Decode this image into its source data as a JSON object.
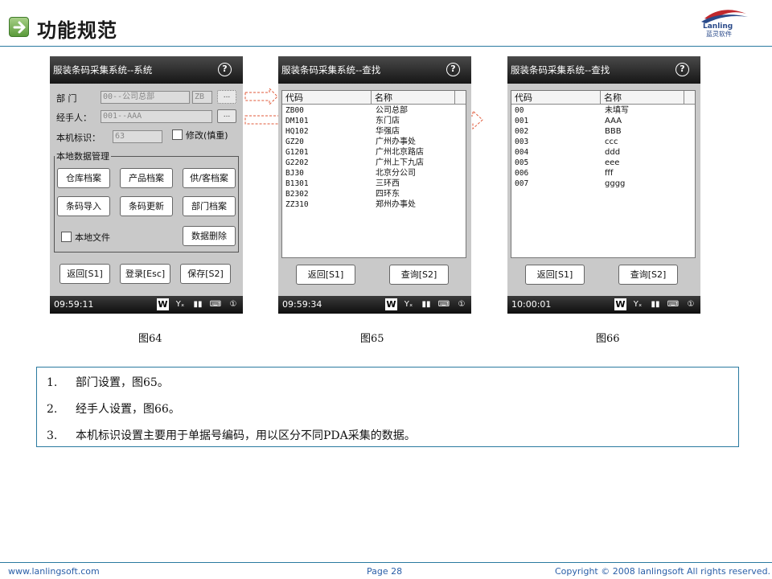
{
  "header": {
    "title": "功能规范",
    "logo_text": "Lanling",
    "logo_sub": "蓝灵软件"
  },
  "footer": {
    "website": "www.lanlingsoft.com",
    "page": "Page 28",
    "copyright": "Copyright © 2008 lanlingsoft All rights reserved."
  },
  "phone1": {
    "title": "服装条码采集系统--系统",
    "dept_label": "部    门",
    "dept_value": "00--公司总部",
    "dept_code": "ZB",
    "dept_more": "...",
    "handler_label": "经手人：",
    "handler_value": "001--AAA",
    "handler_more": "...",
    "device_label": "本机标识：",
    "device_value": "63",
    "modify_label": "修改(慎重)",
    "group_title": "本地数据管理",
    "buttons": [
      "仓库档案",
      "产品档案",
      "供/客档案",
      "条码导入",
      "条码更新",
      "部门档案"
    ],
    "local_file_label": "本地文件",
    "delete_button": "数据删除",
    "bottom_buttons": [
      "返回[S1]",
      "登录[Esc]",
      "保存[S2]"
    ],
    "time": "09:59:11"
  },
  "phone2": {
    "title": "服装条码采集系统--查找",
    "col_code": "代码",
    "col_name": "名称",
    "rows": [
      [
        "ZB00",
        "公司总部"
      ],
      [
        "DM101",
        "东门店"
      ],
      [
        "HQ102",
        "华强店"
      ],
      [
        "GZ20",
        "广州办事处"
      ],
      [
        "G1201",
        "广州北京路店"
      ],
      [
        "G2202",
        "广州上下九店"
      ],
      [
        "BJ30",
        "北京分公司"
      ],
      [
        "B1301",
        "三环西"
      ],
      [
        "B2302",
        "四环东"
      ],
      [
        "ZZ310",
        "郑州办事处"
      ]
    ],
    "bottom_buttons": [
      "返回[S1]",
      "查询[S2]"
    ],
    "time": "09:59:34"
  },
  "phone3": {
    "title": "服装条码采集系统--查找",
    "col_code": "代码",
    "col_name": "名称",
    "rows": [
      [
        "00",
        "未填写"
      ],
      [
        "001",
        "AAA"
      ],
      [
        "002",
        "BBB"
      ],
      [
        "003",
        "ccc"
      ],
      [
        "004",
        "ddd"
      ],
      [
        "005",
        "eee"
      ],
      [
        "006",
        "fff"
      ],
      [
        "007",
        "gggg"
      ]
    ],
    "bottom_buttons": [
      "返回[S1]",
      "查询[S2]"
    ],
    "time": "10:00:01"
  },
  "status_icons": [
    "windows-icon",
    "signal-off-icon",
    "battery-icon",
    "keyboard-icon",
    "sync-icon"
  ],
  "captions": [
    "图64",
    "图65",
    "图66"
  ],
  "notes": [
    {
      "num": "1.",
      "text": "部门设置，图65。"
    },
    {
      "num": "2.",
      "text": "经手人设置，图66。"
    },
    {
      "num": "3.",
      "text": "本机标识设置主要用于单据号编码，用以区分不同PDA采集的数据。"
    }
  ],
  "colors": {
    "accent_line": "#2a7aa0",
    "footer_text": "#2a5fa8",
    "arrow": "#e05a3a"
  }
}
